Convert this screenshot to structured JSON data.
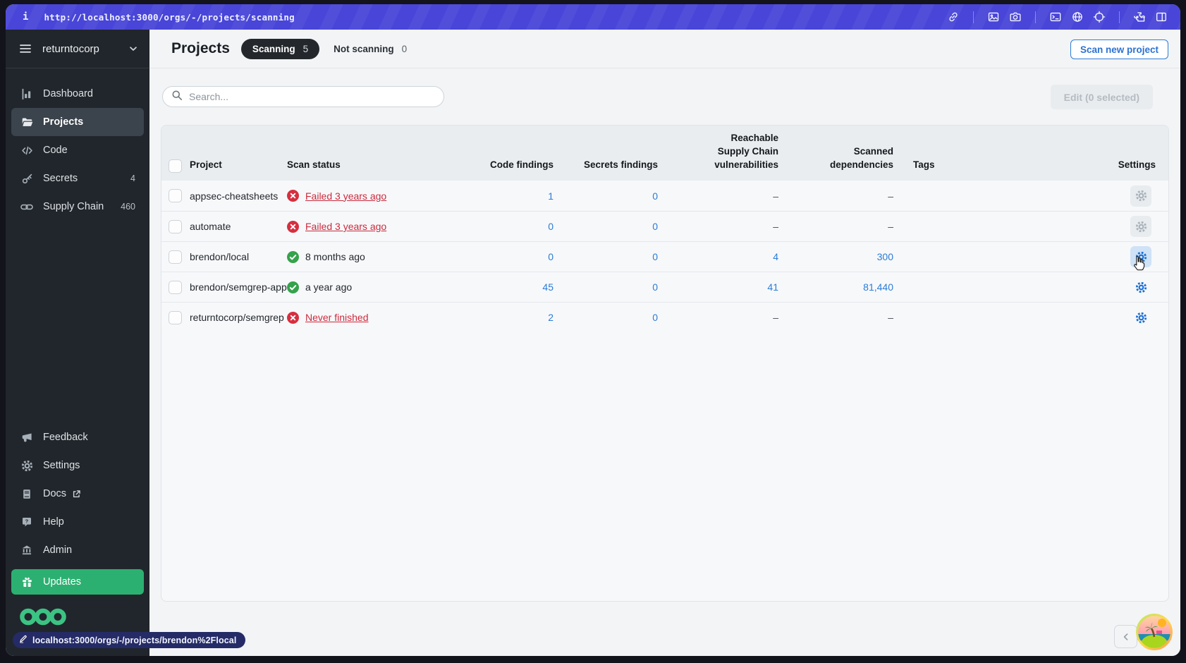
{
  "browser_bar": {
    "info_glyph": "i",
    "url": "http://localhost:3000/orgs/-/projects/scanning",
    "icons": [
      "link-icon",
      "screenshot-icon",
      "camera-icon",
      "terminal-icon",
      "globe-icon",
      "crosshair-icon",
      "extensions-icon",
      "split-view-icon"
    ]
  },
  "sidebar": {
    "org_name": "returntocorp",
    "nav": [
      {
        "id": "dashboard",
        "label": "Dashboard",
        "icon": "chart",
        "badge": "",
        "active": false
      },
      {
        "id": "projects",
        "label": "Projects",
        "icon": "folder",
        "badge": "",
        "active": true
      },
      {
        "id": "code",
        "label": "Code",
        "icon": "code",
        "badge": "",
        "active": false
      },
      {
        "id": "secrets",
        "label": "Secrets",
        "icon": "key",
        "badge": "4",
        "active": false
      },
      {
        "id": "supply-chain",
        "label": "Supply Chain",
        "icon": "chain",
        "badge": "460",
        "active": false
      }
    ],
    "bottom_nav": [
      {
        "id": "feedback",
        "label": "Feedback",
        "icon": "megaphone",
        "external": false
      },
      {
        "id": "settings",
        "label": "Settings",
        "icon": "gear",
        "external": false
      },
      {
        "id": "docs",
        "label": "Docs",
        "icon": "book",
        "external": true
      },
      {
        "id": "help",
        "label": "Help",
        "icon": "help",
        "external": false
      },
      {
        "id": "admin",
        "label": "Admin",
        "icon": "bank",
        "external": false
      }
    ],
    "updates_label": "Updates",
    "logo": "semgrep-logo"
  },
  "header": {
    "title": "Projects",
    "tabs": [
      {
        "label": "Scanning",
        "count": "5",
        "active": true
      },
      {
        "label": "Not scanning",
        "count": "0",
        "active": false
      }
    ],
    "scan_new_project": "Scan new project"
  },
  "toolbar": {
    "search_placeholder": "Search...",
    "edit_button": "Edit (0 selected)"
  },
  "table": {
    "columns": [
      "Project",
      "Scan status",
      "Code findings",
      "Secrets findings",
      "Reachable\nSupply Chain\nvulnerabilities",
      "Scanned\ndependencies",
      "Tags",
      "Settings"
    ],
    "rows": [
      {
        "project": "appsec-cheatsheets",
        "status": {
          "text": "Failed 3 years ago",
          "state": "failed"
        },
        "code_findings": "1",
        "secrets_findings": "0",
        "reachable_vulnerabilities": "–",
        "scanned_dependencies": "–",
        "tags": "",
        "gear": "muted"
      },
      {
        "project": "automate",
        "status": {
          "text": "Failed 3 years ago",
          "state": "failed"
        },
        "code_findings": "0",
        "secrets_findings": "0",
        "reachable_vulnerabilities": "–",
        "scanned_dependencies": "–",
        "tags": "",
        "gear": "muted"
      },
      {
        "project": "brendon/local",
        "status": {
          "text": "8 months ago",
          "state": "success"
        },
        "code_findings": "0",
        "secrets_findings": "0",
        "reachable_vulnerabilities": "4",
        "scanned_dependencies": "300",
        "tags": "",
        "gear": "hover"
      },
      {
        "project": "brendon/semgrep-app",
        "status": {
          "text": "a year ago",
          "state": "success"
        },
        "code_findings": "45",
        "secrets_findings": "0",
        "reachable_vulnerabilities": "41",
        "scanned_dependencies": "81,440",
        "tags": "",
        "gear": "plain"
      },
      {
        "project": "returntocorp/semgrep",
        "status": {
          "text": "Never finished",
          "state": "failed"
        },
        "code_findings": "2",
        "secrets_findings": "0",
        "reachable_vulnerabilities": "–",
        "scanned_dependencies": "–",
        "tags": "",
        "gear": "plain"
      }
    ]
  },
  "footer": {
    "status_tooltip": "localhost:3000/orgs/-/projects/brendon%2Flocal",
    "pagination_prev": "<"
  },
  "colors": {
    "topbar_blue": "#4845d8",
    "sidebar_dark": "#21262c",
    "accent_green": "#2cb071",
    "logo_green": "#3cc383",
    "link_blue": "#2b7cd5",
    "danger_red": "#d62f3f",
    "success_green": "#35a24c"
  }
}
